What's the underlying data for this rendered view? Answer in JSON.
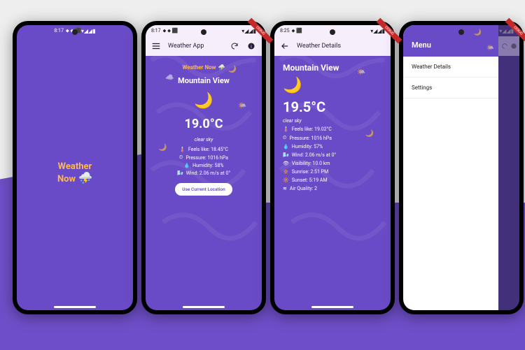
{
  "splash": {
    "statusTime": "8:17",
    "titleLine1": "Weather",
    "titleLine2": "Now"
  },
  "home": {
    "statusTime": "8:17",
    "appbarTitle": "Weather App",
    "brand": "Weather Now",
    "city": "Mountain View",
    "temp": "19.0°C",
    "desc": "clear sky",
    "feelsLike": "Feels like: 18.45°C",
    "pressure": "Pressure: 1016 hPa",
    "humidity": "Humidity: 58%",
    "wind": "Wind: 2.06 m/s at 0°",
    "buttonLabel": "Use Current Location"
  },
  "details": {
    "statusTime": "8:25",
    "appbarTitle": "Weather Details",
    "city": "Mountain View",
    "temp": "19.5°C",
    "desc": "clear sky",
    "feelsLike": "Feels like: 19.02°C",
    "pressure": "Pressure: 1016 hPa",
    "humidity": "Humidity: 57%",
    "wind": "Wind: 2.06 m/s at 0°",
    "visibility": "Visibility: 10.0 km",
    "sunrise": "Sunrise: 2:51 PM",
    "sunset": "Sunset: 5:19 AM",
    "airQuality": "Air Quality: 2"
  },
  "drawer": {
    "headerTitle": "Menu",
    "items": [
      "Weather Details",
      "Settings"
    ]
  },
  "debugRibbon": "DEBUG"
}
